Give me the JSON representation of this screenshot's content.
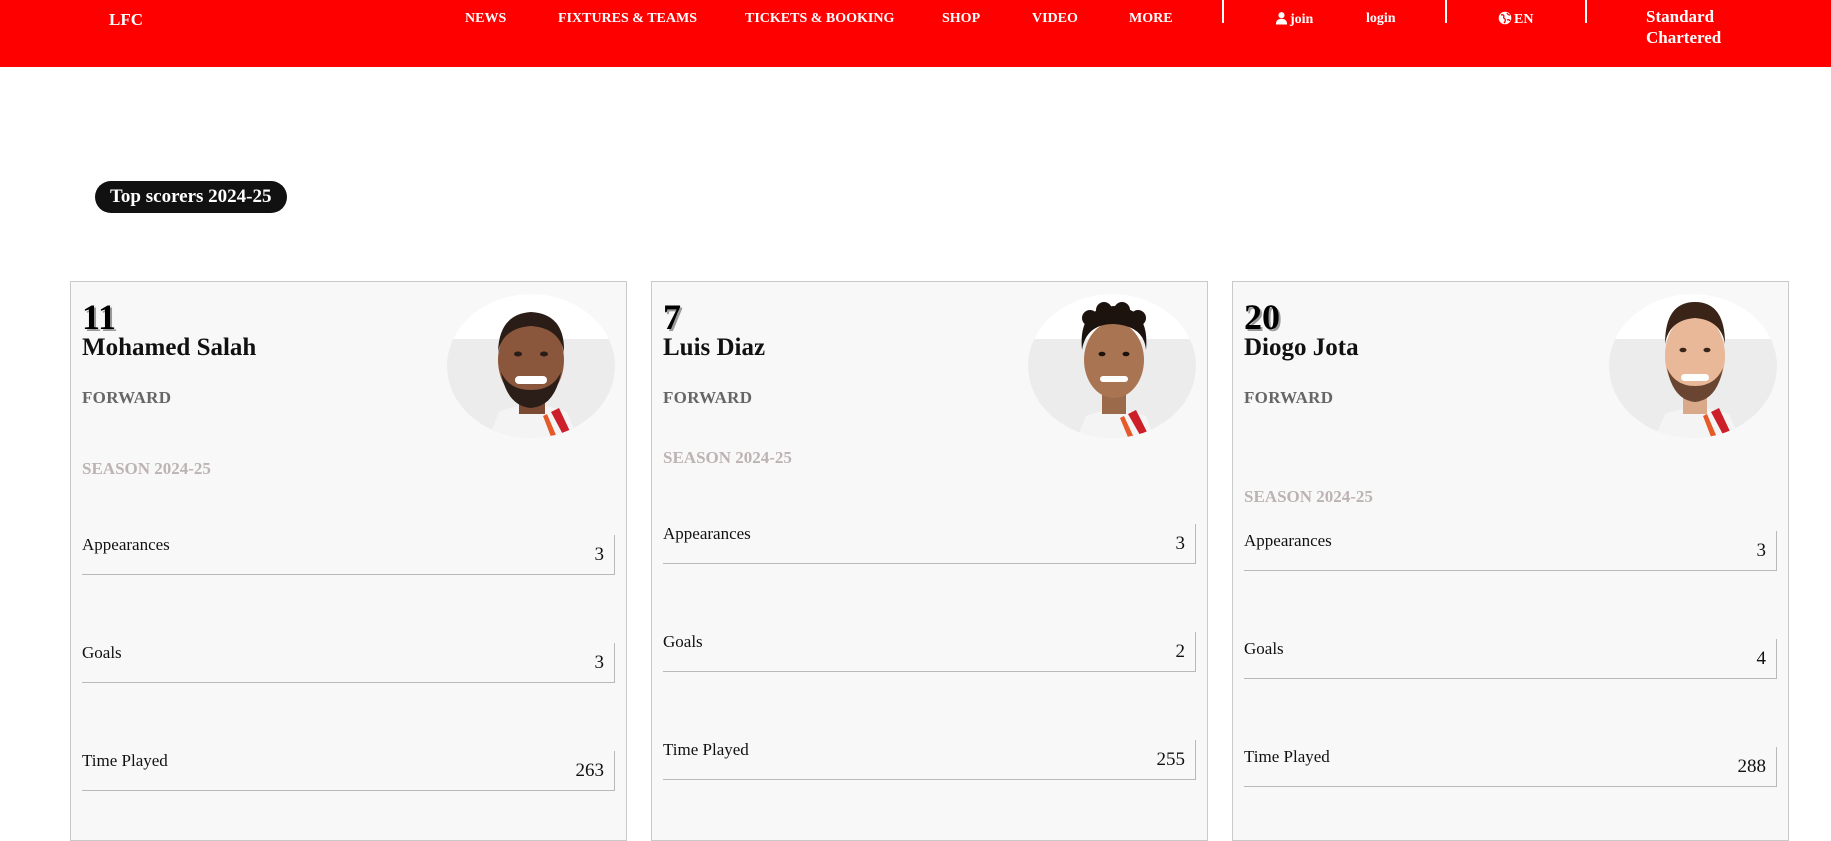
{
  "nav": {
    "logo": "LFC",
    "items": [
      "NEWS",
      "FIXTURES & TEAMS",
      "TICKETS & BOOKING",
      "SHOP",
      "VIDEO",
      "MORE"
    ],
    "join": "join",
    "login": "login",
    "language": "EN",
    "sponsor_line1": "Standard",
    "sponsor_line2": "Chartered"
  },
  "section": {
    "title": "Top scorers 2024-25"
  },
  "players": [
    {
      "number": "11",
      "name": "Mohamed Salah",
      "position": "FORWARD",
      "season": "SEASON 2024-25",
      "stats": [
        {
          "label": "Appearances",
          "value": "3"
        },
        {
          "label": "Goals",
          "value": "3"
        },
        {
          "label": "Time Played",
          "value": "263"
        }
      ]
    },
    {
      "number": "7",
      "name": "Luis Diaz",
      "position": "FORWARD",
      "season": "SEASON 2024-25",
      "stats": [
        {
          "label": "Appearances",
          "value": "3"
        },
        {
          "label": "Goals",
          "value": "2"
        },
        {
          "label": "Time Played",
          "value": "255"
        }
      ]
    },
    {
      "number": "20",
      "name": "Diogo Jota",
      "position": "FORWARD",
      "season": "SEASON 2024-25",
      "stats": [
        {
          "label": "Appearances",
          "value": "3"
        },
        {
          "label": "Goals",
          "value": "4"
        },
        {
          "label": "Time Played",
          "value": "288"
        }
      ]
    }
  ],
  "colors": {
    "brand_red": "#ff0000",
    "pill_bg": "#111111",
    "card_bg": "#f8f8f8",
    "season_text": "#bdb3b3"
  },
  "icons": {
    "user": "user-icon",
    "language": "globe-icon",
    "player_photo": "player-photo"
  }
}
